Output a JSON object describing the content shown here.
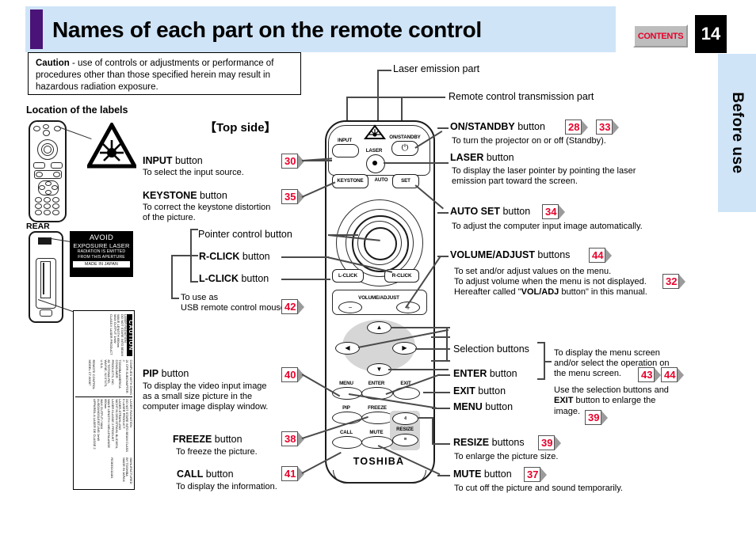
{
  "header": {
    "title": "Names of each part on the remote control",
    "contents_label": "CONTENTS",
    "page_number": "14"
  },
  "side_tab": {
    "label": "Before use"
  },
  "caution_box": {
    "lead": "Caution",
    "text": " - use of controls or adjustments or performance of procedures other than those specified herein may result in hazardous radiation exposure."
  },
  "location_section": {
    "title": "Location of the labels",
    "rear_label": "REAR",
    "avoid_label": {
      "line1": "AVOID",
      "line2": "EXPOSURE LASER",
      "line3a": "RADIATION IS EMITTED",
      "line3b": "FROM THIS APERTURE",
      "made_in": "MADE IN JAPAN"
    },
    "big_label": {
      "caution_bar": "CAUTION",
      "col1_l1": "LASER RADIATION",
      "col1_l2": "DO NOT STARE INTO BEAM",
      "col1_l3": "WAVE LENGTH           650nm",
      "col1_l4": "MAX OUTPUT            1mW",
      "col1_l5": "CLASS II LASER PRODUCT",
      "col2_l1": "COMPLIES WITH DHHS 21 CFR SUBCHAPTER J",
      "col2_l2": "TOSHIBA AMERICA CONSUMER PRODUCTS, INC.",
      "col2_l3": "82 TOTOWA RD, WAYNE, NJ 07470, U.S.A.",
      "col3_l1": "REMOTE CONTROL      MODEL  CT-90087",
      "col4_l1": "LASER RADIATION",
      "col4_l2": "DO NOT STARE INTO BEAM CLASS II LASER PRODUCT",
      "col4_l3": "LASER-STRAHLUNG",
      "col4_l4": "NICHT IN DEN STRAHL BLICKEN, LASER KLASSE 2 PRODUKT",
      "col4_l5": "WAVE LENGTH / WELLENLANGE      650nm",
      "col4_l6": "MAX OUTPUT / MAX AUSGANGSLEISTUNG   1mW",
      "col4_l7": "APPAREIL A LASER DE CLASSE 2",
      "col5_l1": "MANUFACTURED",
      "col5_l2": "BY TOSHIBA",
      "col5_l3": "MADE IN JAPAN",
      "code": "RC8001/11181"
    }
  },
  "diagram": {
    "top_side_title": "【Top side】",
    "brand": "TOSHIBA",
    "button_labels": {
      "input": "INPUT",
      "on_standby": "ON/STANDBY",
      "laser": "LASER",
      "keystone": "KEYSTONE",
      "auto": "AUTO",
      "set": "SET",
      "l_click": "L-CLICK",
      "r_click": "R-CLICK",
      "volume_adjust": "VOLUME/ADJUST",
      "minus": "−",
      "plus": "+",
      "up": "▲",
      "down": "▼",
      "left": "◀",
      "right": "▶",
      "menu": "MENU",
      "enter": "ENTER",
      "exit": "EXIT",
      "pip": "PIP",
      "freeze": "FREEZE",
      "call": "CALL",
      "mute": "MUTE",
      "resize": "RESIZE",
      "resize_up": "ⱏ",
      "resize_down": "ⱎ",
      "power_glyph": "⏻"
    }
  },
  "callouts": {
    "laser_emission": {
      "title": "Laser emission part"
    },
    "transmission": {
      "title": "Remote control transmission part"
    },
    "input": {
      "name": "INPUT",
      "suffix": " button",
      "desc": "To select the input source.",
      "refs": [
        "30"
      ]
    },
    "keystone": {
      "name": "KEYSTONE",
      "suffix": " button",
      "desc_l1": "To correct the keystone distortion",
      "desc_l2": "of the picture.",
      "refs": [
        "35"
      ]
    },
    "pointer": {
      "title": "Pointer control button"
    },
    "r_click": {
      "name": "R-CLICK",
      "suffix": " button"
    },
    "l_click": {
      "name": "L-CLICK",
      "suffix": " button"
    },
    "usb_mouse": {
      "l1": "To use as",
      "l2": "USB remote control mouse.",
      "refs": [
        "42"
      ]
    },
    "pip": {
      "name": "PIP",
      "suffix": " button",
      "desc_l1": "To display the video input image",
      "desc_l2": "as a small size picture in the",
      "desc_l3": "computer image display window.",
      "refs": [
        "40"
      ]
    },
    "freeze": {
      "name": "FREEZE",
      "suffix": " button",
      "desc": "To freeze the picture.",
      "refs": [
        "38"
      ]
    },
    "call": {
      "name": "CALL",
      "suffix": " button",
      "desc": "To display the information.",
      "refs": [
        "41"
      ]
    },
    "on_standby": {
      "name": "ON/STANDBY",
      "suffix": " button",
      "desc": "To turn the projector on or off (Standby).",
      "refs": [
        "28",
        "33"
      ]
    },
    "laser": {
      "name": "LASER",
      "suffix": " button",
      "desc_l1": "To display the laser pointer by pointing the laser",
      "desc_l2": "emission part toward the screen."
    },
    "auto_set": {
      "name": "AUTO SET",
      "suffix": " button",
      "desc": "To adjust the computer input image automatically.",
      "refs": [
        "34"
      ]
    },
    "volume_adjust": {
      "name": "VOLUME/ADJUST",
      "suffix": " buttons",
      "desc_l1": "To set and/or adjust values on the menu.",
      "desc_l2": "To adjust volume when the menu is not displayed.",
      "desc_l3a": "Hereafter called \"",
      "desc_l3b": "VOL/ADJ",
      "desc_l3c": " button\" in this manual.",
      "refs": [
        "44"
      ],
      "inline_ref": [
        "32"
      ]
    },
    "selection": {
      "title": "Selection buttons"
    },
    "enter": {
      "name": "ENTER",
      "suffix": " button"
    },
    "exit": {
      "name": "EXIT",
      "suffix": " button"
    },
    "menu": {
      "name": "MENU",
      "suffix": " button"
    },
    "menu_desc": {
      "l1": "To display the menu screen",
      "l2": "and/or select the operation on",
      "l3": "the menu screen.",
      "refs": [
        "43",
        "44"
      ],
      "l4": "Use the selection buttons and",
      "l5a": "EXIT",
      "l5b": " button to enlarge the",
      "l6": "image.",
      "refs2": [
        "39"
      ]
    },
    "resize": {
      "name": "RESIZE",
      "suffix": " buttons",
      "desc": "To enlarge the picture size.",
      "refs": [
        "39"
      ]
    },
    "mute": {
      "name": "MUTE",
      "suffix": " button",
      "desc": "To cut off the picture and sound temporarily.",
      "refs": [
        "37"
      ]
    }
  },
  "colors": {
    "band": "#cfe4f7",
    "accent_purple": "#4a1377",
    "ref_red": "#e8002a",
    "line_gray": "#4a4a4a"
  }
}
